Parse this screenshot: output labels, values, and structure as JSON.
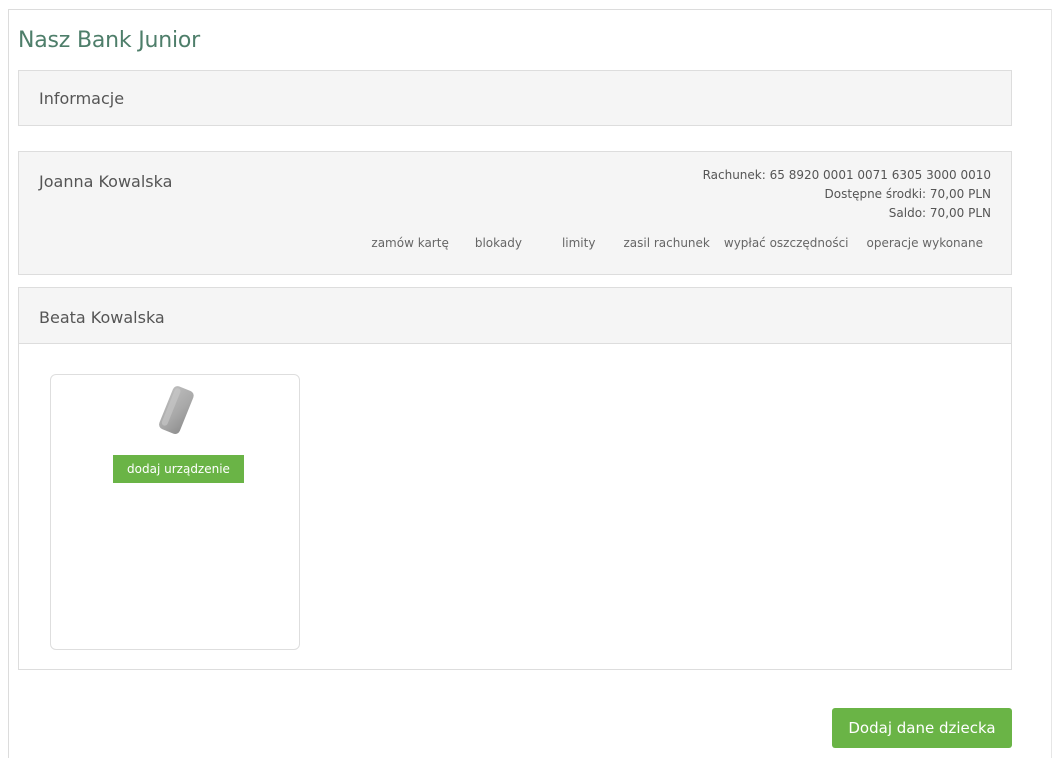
{
  "page": {
    "title": "Nasz Bank Junior"
  },
  "info_panel": {
    "title": "Informacje"
  },
  "child_1": {
    "name": "Joanna Kowalska",
    "account": {
      "number_label": "Rachunek:",
      "number": "65 8920 0001 0071 6305 3000 0010",
      "available_label": "Dostępne środki:",
      "available": "70,00 PLN",
      "balance_label": "Saldo:",
      "balance": "70,00 PLN"
    },
    "actions": [
      "zamów kartę",
      "blokady",
      "limity",
      "zasil rachunek",
      "wypłać oszczędności",
      "operacje wykonane"
    ]
  },
  "child_2": {
    "name": "Beata Kowalska",
    "device_card": {
      "icon": "mobile-device-icon",
      "add_button": "dodaj urządzenie"
    }
  },
  "footer": {
    "add_child_button": "Dodaj dane dziecka"
  },
  "colors": {
    "title": "#4e7e6a",
    "accent_green": "#6ab446",
    "panel_bg": "#f5f5f5",
    "border": "#dddddd"
  }
}
